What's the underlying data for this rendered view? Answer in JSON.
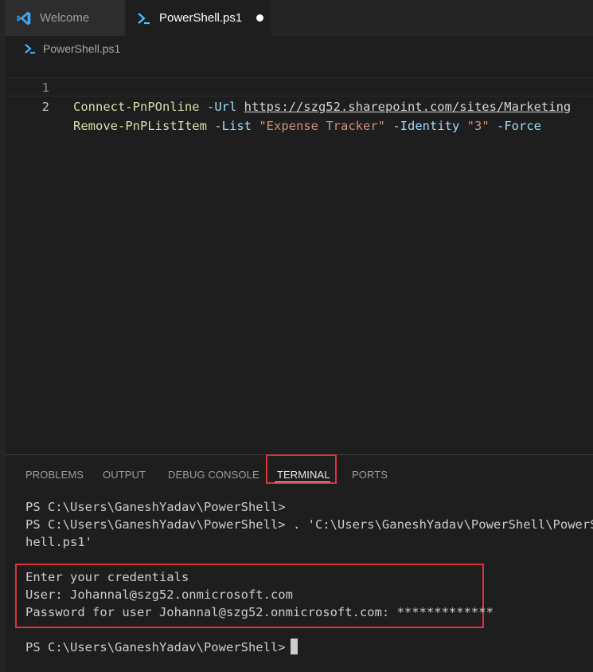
{
  "tabs": [
    {
      "label": "Welcome",
      "icon": "vscode-logo-icon"
    },
    {
      "label": "PowerShell.ps1",
      "icon": "powershell-icon",
      "modified": true
    }
  ],
  "breadcrumb": {
    "file": "PowerShell.ps1"
  },
  "editor": {
    "lines": [
      {
        "number": "1",
        "tokens": {
          "cmd": "Connect-PnPOnline",
          "param": "-Url",
          "url": "https://szg52.sharepoint.com/sites/Marketing"
        }
      },
      {
        "number": "2",
        "tokens": {
          "cmd": "Remove-PnPListItem",
          "param_list": "-List",
          "list_value": "\"Expense Tracker\"",
          "param_identity": "-Identity",
          "identity_value": "\"3\"",
          "param_force": "-Force"
        }
      }
    ]
  },
  "panel": {
    "tabs": [
      "PROBLEMS",
      "OUTPUT",
      "DEBUG CONSOLE",
      "TERMINAL",
      "PORTS"
    ],
    "active_tab": "TERMINAL"
  },
  "terminal": {
    "lines": [
      "PS C:\\Users\\GaneshYadav\\PowerShell>",
      "PS C:\\Users\\GaneshYadav\\PowerShell> . 'C:\\Users\\GaneshYadav\\PowerShell\\PowerS",
      "hell.ps1'",
      "Enter your credentials",
      "User: Johannal@szg52.onmicrosoft.com",
      "Password for user Johannal@szg52.onmicrosoft.com: *************",
      "PS C:\\Users\\GaneshYadav\\PowerShell>"
    ]
  },
  "colors": {
    "highlight_box": "#d9343b",
    "background": "#1e1e1e",
    "function": "#dcdcaa",
    "parameter": "#9cdcfe",
    "string": "#ce9178"
  }
}
